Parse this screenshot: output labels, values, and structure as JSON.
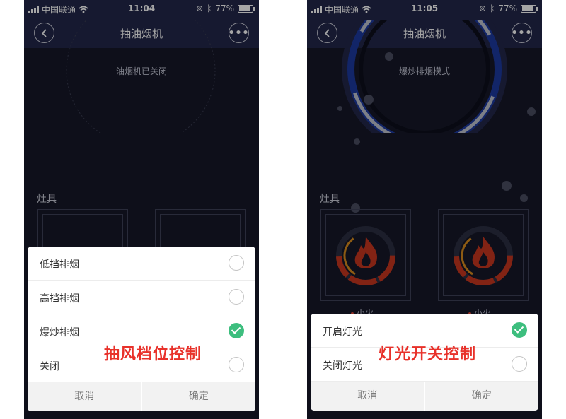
{
  "status_bar": {
    "carrier": "中国联通",
    "battery": "77%",
    "battery_level": 0.77
  },
  "left_screen": {
    "time": "11:04",
    "nav_title": "抽油烟机",
    "status_text": "油烟机已关闭",
    "section_label": "灶具",
    "sheet": {
      "options": [
        {
          "label": "低挡排烟",
          "selected": false
        },
        {
          "label": "高挡排烟",
          "selected": false
        },
        {
          "label": "爆炒排烟",
          "selected": true
        },
        {
          "label": "关闭",
          "selected": false
        }
      ],
      "cancel": "取消",
      "confirm": "确定"
    },
    "caption": "抽风档位控制"
  },
  "right_screen": {
    "time": "11:05",
    "nav_title": "抽油烟机",
    "status_text": "爆炒排烟模式",
    "section_label": "灶具",
    "stove_labels": [
      "小火",
      "小火"
    ],
    "sheet": {
      "options": [
        {
          "label": "开启灯光",
          "selected": true
        },
        {
          "label": "关闭灯光",
          "selected": false
        }
      ],
      "cancel": "取消",
      "confirm": "确定"
    },
    "caption": "灯光开关控制"
  },
  "icons": {
    "back": "chevron-left-icon",
    "more": "more-dots-icon",
    "flame": "flame-icon"
  },
  "colors": {
    "navbar": "#22274a",
    "background": "#161828",
    "selected": "#3dbe7e",
    "caption": "#e8312a",
    "ring_blue": "#1d3aa0"
  }
}
